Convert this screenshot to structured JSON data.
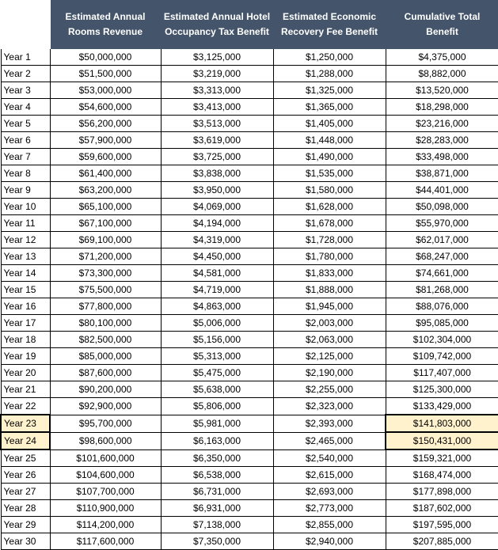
{
  "table": {
    "headers": [
      "",
      "Estimated Annual Rooms Revenue",
      "Estimated Annual Hotel Occupancy Tax Benefit",
      "Estimated Economic Recovery Fee Benefit",
      "Cumulative Total Benefit"
    ],
    "highlight_color": "#fff2cc",
    "header_color": "#44546a",
    "rows": [
      {
        "year": "Year 1",
        "revenue": "$50,000,000",
        "hot": "$3,125,000",
        "erf": "$1,250,000",
        "total": "$4,375,000"
      },
      {
        "year": "Year 2",
        "revenue": "$51,500,000",
        "hot": "$3,219,000",
        "erf": "$1,288,000",
        "total": "$8,882,000"
      },
      {
        "year": "Year 3",
        "revenue": "$53,000,000",
        "hot": "$3,313,000",
        "erf": "$1,325,000",
        "total": "$13,520,000"
      },
      {
        "year": "Year 4",
        "revenue": "$54,600,000",
        "hot": "$3,413,000",
        "erf": "$1,365,000",
        "total": "$18,298,000"
      },
      {
        "year": "Year 5",
        "revenue": "$56,200,000",
        "hot": "$3,513,000",
        "erf": "$1,405,000",
        "total": "$23,216,000"
      },
      {
        "year": "Year 6",
        "revenue": "$57,900,000",
        "hot": "$3,619,000",
        "erf": "$1,448,000",
        "total": "$28,283,000"
      },
      {
        "year": "Year 7",
        "revenue": "$59,600,000",
        "hot": "$3,725,000",
        "erf": "$1,490,000",
        "total": "$33,498,000"
      },
      {
        "year": "Year 8",
        "revenue": "$61,400,000",
        "hot": "$3,838,000",
        "erf": "$1,535,000",
        "total": "$38,871,000"
      },
      {
        "year": "Year 9",
        "revenue": "$63,200,000",
        "hot": "$3,950,000",
        "erf": "$1,580,000",
        "total": "$44,401,000"
      },
      {
        "year": "Year 10",
        "revenue": "$65,100,000",
        "hot": "$4,069,000",
        "erf": "$1,628,000",
        "total": "$50,098,000"
      },
      {
        "year": "Year 11",
        "revenue": "$67,100,000",
        "hot": "$4,194,000",
        "erf": "$1,678,000",
        "total": "$55,970,000"
      },
      {
        "year": "Year 12",
        "revenue": "$69,100,000",
        "hot": "$4,319,000",
        "erf": "$1,728,000",
        "total": "$62,017,000"
      },
      {
        "year": "Year 13",
        "revenue": "$71,200,000",
        "hot": "$4,450,000",
        "erf": "$1,780,000",
        "total": "$68,247,000"
      },
      {
        "year": "Year 14",
        "revenue": "$73,300,000",
        "hot": "$4,581,000",
        "erf": "$1,833,000",
        "total": "$74,661,000"
      },
      {
        "year": "Year 15",
        "revenue": "$75,500,000",
        "hot": "$4,719,000",
        "erf": "$1,888,000",
        "total": "$81,268,000"
      },
      {
        "year": "Year 16",
        "revenue": "$77,800,000",
        "hot": "$4,863,000",
        "erf": "$1,945,000",
        "total": "$88,076,000"
      },
      {
        "year": "Year 17",
        "revenue": "$80,100,000",
        "hot": "$5,006,000",
        "erf": "$2,003,000",
        "total": "$95,085,000"
      },
      {
        "year": "Year 18",
        "revenue": "$82,500,000",
        "hot": "$5,156,000",
        "erf": "$2,063,000",
        "total": "$102,304,000"
      },
      {
        "year": "Year 19",
        "revenue": "$85,000,000",
        "hot": "$5,313,000",
        "erf": "$2,125,000",
        "total": "$109,742,000"
      },
      {
        "year": "Year 20",
        "revenue": "$87,600,000",
        "hot": "$5,475,000",
        "erf": "$2,190,000",
        "total": "$117,407,000"
      },
      {
        "year": "Year 21",
        "revenue": "$90,200,000",
        "hot": "$5,638,000",
        "erf": "$2,255,000",
        "total": "$125,300,000"
      },
      {
        "year": "Year 22",
        "revenue": "$92,900,000",
        "hot": "$5,806,000",
        "erf": "$2,323,000",
        "total": "$133,429,000"
      },
      {
        "year": "Year 23",
        "revenue": "$95,700,000",
        "hot": "$5,981,000",
        "erf": "$2,393,000",
        "total": "$141,803,000",
        "highlight": true
      },
      {
        "year": "Year 24",
        "revenue": "$98,600,000",
        "hot": "$6,163,000",
        "erf": "$2,465,000",
        "total": "$150,431,000",
        "highlight": true
      },
      {
        "year": "Year 25",
        "revenue": "$101,600,000",
        "hot": "$6,350,000",
        "erf": "$2,540,000",
        "total": "$159,321,000"
      },
      {
        "year": "Year 26",
        "revenue": "$104,600,000",
        "hot": "$6,538,000",
        "erf": "$2,615,000",
        "total": "$168,474,000"
      },
      {
        "year": "Year 27",
        "revenue": "$107,700,000",
        "hot": "$6,731,000",
        "erf": "$2,693,000",
        "total": "$177,898,000"
      },
      {
        "year": "Year 28",
        "revenue": "$110,900,000",
        "hot": "$6,931,000",
        "erf": "$2,773,000",
        "total": "$187,602,000"
      },
      {
        "year": "Year 29",
        "revenue": "$114,200,000",
        "hot": "$7,138,000",
        "erf": "$2,855,000",
        "total": "$197,595,000"
      },
      {
        "year": "Year 30",
        "revenue": "$117,600,000",
        "hot": "$7,350,000",
        "erf": "$2,940,000",
        "total": "$207,885,000"
      }
    ]
  }
}
